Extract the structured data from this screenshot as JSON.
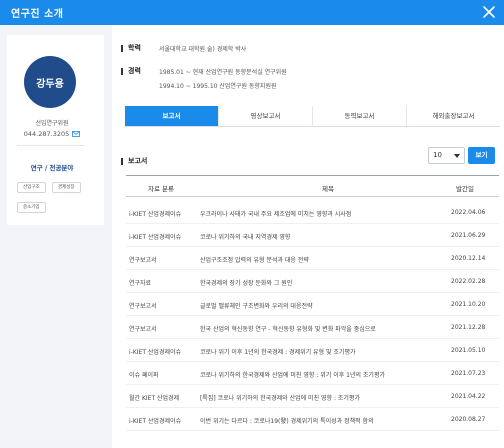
{
  "header": {
    "title": "연구진 소개"
  },
  "profile": {
    "name": "강두용",
    "org": "선임연구위원",
    "phone": "044.287.3205",
    "field_title": "연구 / 전공분야",
    "tags": [
      "산업구조",
      "경제성장",
      "중소기업"
    ]
  },
  "info": {
    "education_label": "학력",
    "education": [
      "서울대학교 대학원 술) 경제학 박사"
    ],
    "career_label": "경력",
    "career": [
      "1985.01 ~ 현재 산업연구원 동향분석실 연구위원",
      "1994.10 ~ 1995.10 산업연구원 동향지원원"
    ]
  },
  "tabs": [
    "보고서",
    "영상보고서",
    "동력보고서",
    "해외출장보고서"
  ],
  "reports": {
    "section_title": "보고서",
    "page_size": "10",
    "view_label": "보기",
    "columns": [
      "자료 분류",
      "제목",
      "발간일"
    ],
    "rows": [
      {
        "category": "i-KIET 산업경제이슈",
        "title": "우크라이나 사태가 국내 주요 제조업에 미치는 영향과 시사점",
        "date": "2022.04.06"
      },
      {
        "category": "i-KIET 산업경제이슈",
        "title": "코로나 위기하의 국내 지역경제 영향",
        "date": "2021.06.29"
      },
      {
        "category": "연구보고서",
        "title": "산업구조조정 압력의 유형 분석과 대응 전략",
        "date": "2020.12.14"
      },
      {
        "category": "연구자료",
        "title": "한국경제의 장기 성장 둔화와 그 원인",
        "date": "2022.02.28"
      },
      {
        "category": "연구보고서",
        "title": "글로벌 밸류체인 구조변화와 우리의 대응전략",
        "date": "2021.10.20"
      },
      {
        "category": "연구보고서",
        "title": "한국 산업의 혁신동향 연구 - 혁신동향 유형화 및 변화 파악을 중심으로",
        "date": "2021.12.28"
      },
      {
        "category": "i-KIET 산업경제이슈",
        "title": "코로나 위기 이후 1년의 한국경제 : 경제위기 유형 및 조기평가",
        "date": "2021.05.10"
      },
      {
        "category": "이슈 페이퍼",
        "title": "코로나 위기하의 한국경제와 산업에 미친 영향 : 위기 이후 1년의 조기평가",
        "date": "2021.07.23"
      },
      {
        "category": "월간 KIET 산업경제",
        "title": "[특집] 코로나 위기하의 한국경제와 산업에 미친 영향 : 조기평가",
        "date": "2021.04.22"
      },
      {
        "category": "i-KIET 산업경제이슈",
        "title": "이번 위기는 다르다 : 코로나19(發) 경제위기의 특이성과 정책적 함의",
        "date": "2020.08.27"
      }
    ]
  },
  "colors": {
    "accent": "#1a8bea",
    "avatar": "#214c8c",
    "field_title": "#1f4c90"
  }
}
